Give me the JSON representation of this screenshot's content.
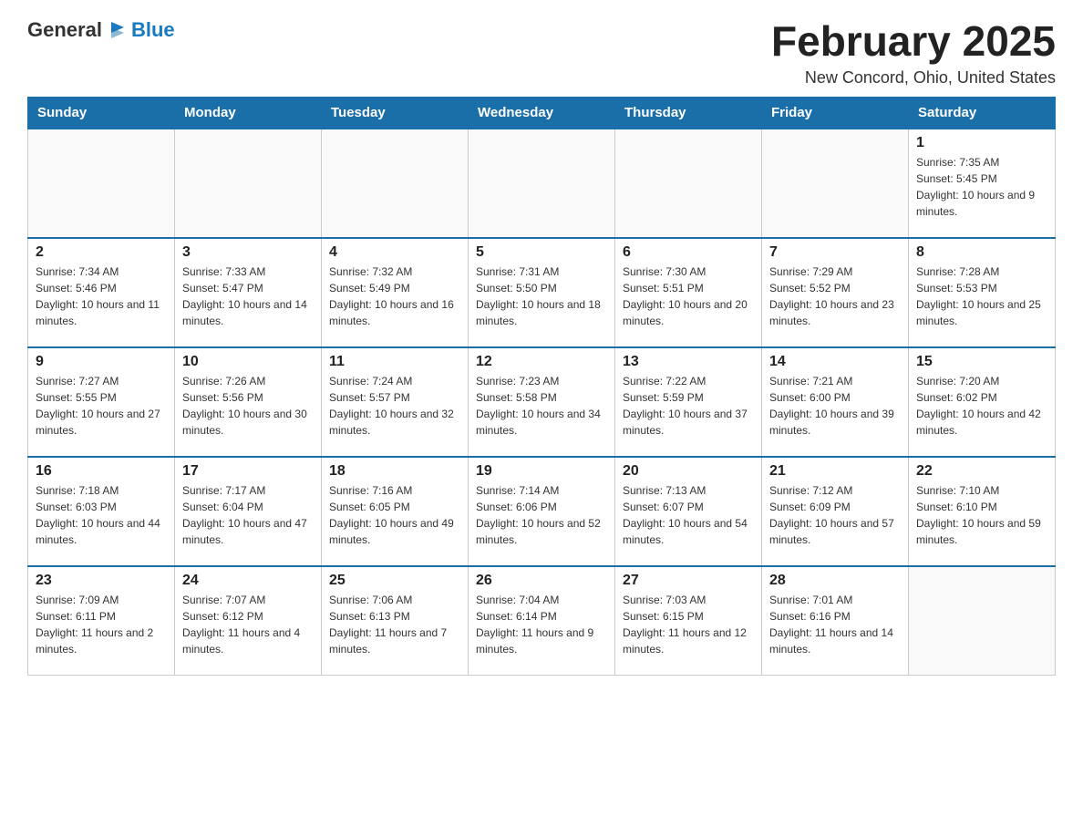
{
  "header": {
    "logo_general": "General",
    "logo_blue": "Blue",
    "month_title": "February 2025",
    "location": "New Concord, Ohio, United States"
  },
  "days_of_week": [
    "Sunday",
    "Monday",
    "Tuesday",
    "Wednesday",
    "Thursday",
    "Friday",
    "Saturday"
  ],
  "weeks": [
    [
      {
        "day": "",
        "info": ""
      },
      {
        "day": "",
        "info": ""
      },
      {
        "day": "",
        "info": ""
      },
      {
        "day": "",
        "info": ""
      },
      {
        "day": "",
        "info": ""
      },
      {
        "day": "",
        "info": ""
      },
      {
        "day": "1",
        "info": "Sunrise: 7:35 AM\nSunset: 5:45 PM\nDaylight: 10 hours and 9 minutes."
      }
    ],
    [
      {
        "day": "2",
        "info": "Sunrise: 7:34 AM\nSunset: 5:46 PM\nDaylight: 10 hours and 11 minutes."
      },
      {
        "day": "3",
        "info": "Sunrise: 7:33 AM\nSunset: 5:47 PM\nDaylight: 10 hours and 14 minutes."
      },
      {
        "day": "4",
        "info": "Sunrise: 7:32 AM\nSunset: 5:49 PM\nDaylight: 10 hours and 16 minutes."
      },
      {
        "day": "5",
        "info": "Sunrise: 7:31 AM\nSunset: 5:50 PM\nDaylight: 10 hours and 18 minutes."
      },
      {
        "day": "6",
        "info": "Sunrise: 7:30 AM\nSunset: 5:51 PM\nDaylight: 10 hours and 20 minutes."
      },
      {
        "day": "7",
        "info": "Sunrise: 7:29 AM\nSunset: 5:52 PM\nDaylight: 10 hours and 23 minutes."
      },
      {
        "day": "8",
        "info": "Sunrise: 7:28 AM\nSunset: 5:53 PM\nDaylight: 10 hours and 25 minutes."
      }
    ],
    [
      {
        "day": "9",
        "info": "Sunrise: 7:27 AM\nSunset: 5:55 PM\nDaylight: 10 hours and 27 minutes."
      },
      {
        "day": "10",
        "info": "Sunrise: 7:26 AM\nSunset: 5:56 PM\nDaylight: 10 hours and 30 minutes."
      },
      {
        "day": "11",
        "info": "Sunrise: 7:24 AM\nSunset: 5:57 PM\nDaylight: 10 hours and 32 minutes."
      },
      {
        "day": "12",
        "info": "Sunrise: 7:23 AM\nSunset: 5:58 PM\nDaylight: 10 hours and 34 minutes."
      },
      {
        "day": "13",
        "info": "Sunrise: 7:22 AM\nSunset: 5:59 PM\nDaylight: 10 hours and 37 minutes."
      },
      {
        "day": "14",
        "info": "Sunrise: 7:21 AM\nSunset: 6:00 PM\nDaylight: 10 hours and 39 minutes."
      },
      {
        "day": "15",
        "info": "Sunrise: 7:20 AM\nSunset: 6:02 PM\nDaylight: 10 hours and 42 minutes."
      }
    ],
    [
      {
        "day": "16",
        "info": "Sunrise: 7:18 AM\nSunset: 6:03 PM\nDaylight: 10 hours and 44 minutes."
      },
      {
        "day": "17",
        "info": "Sunrise: 7:17 AM\nSunset: 6:04 PM\nDaylight: 10 hours and 47 minutes."
      },
      {
        "day": "18",
        "info": "Sunrise: 7:16 AM\nSunset: 6:05 PM\nDaylight: 10 hours and 49 minutes."
      },
      {
        "day": "19",
        "info": "Sunrise: 7:14 AM\nSunset: 6:06 PM\nDaylight: 10 hours and 52 minutes."
      },
      {
        "day": "20",
        "info": "Sunrise: 7:13 AM\nSunset: 6:07 PM\nDaylight: 10 hours and 54 minutes."
      },
      {
        "day": "21",
        "info": "Sunrise: 7:12 AM\nSunset: 6:09 PM\nDaylight: 10 hours and 57 minutes."
      },
      {
        "day": "22",
        "info": "Sunrise: 7:10 AM\nSunset: 6:10 PM\nDaylight: 10 hours and 59 minutes."
      }
    ],
    [
      {
        "day": "23",
        "info": "Sunrise: 7:09 AM\nSunset: 6:11 PM\nDaylight: 11 hours and 2 minutes."
      },
      {
        "day": "24",
        "info": "Sunrise: 7:07 AM\nSunset: 6:12 PM\nDaylight: 11 hours and 4 minutes."
      },
      {
        "day": "25",
        "info": "Sunrise: 7:06 AM\nSunset: 6:13 PM\nDaylight: 11 hours and 7 minutes."
      },
      {
        "day": "26",
        "info": "Sunrise: 7:04 AM\nSunset: 6:14 PM\nDaylight: 11 hours and 9 minutes."
      },
      {
        "day": "27",
        "info": "Sunrise: 7:03 AM\nSunset: 6:15 PM\nDaylight: 11 hours and 12 minutes."
      },
      {
        "day": "28",
        "info": "Sunrise: 7:01 AM\nSunset: 6:16 PM\nDaylight: 11 hours and 14 minutes."
      },
      {
        "day": "",
        "info": ""
      }
    ]
  ]
}
